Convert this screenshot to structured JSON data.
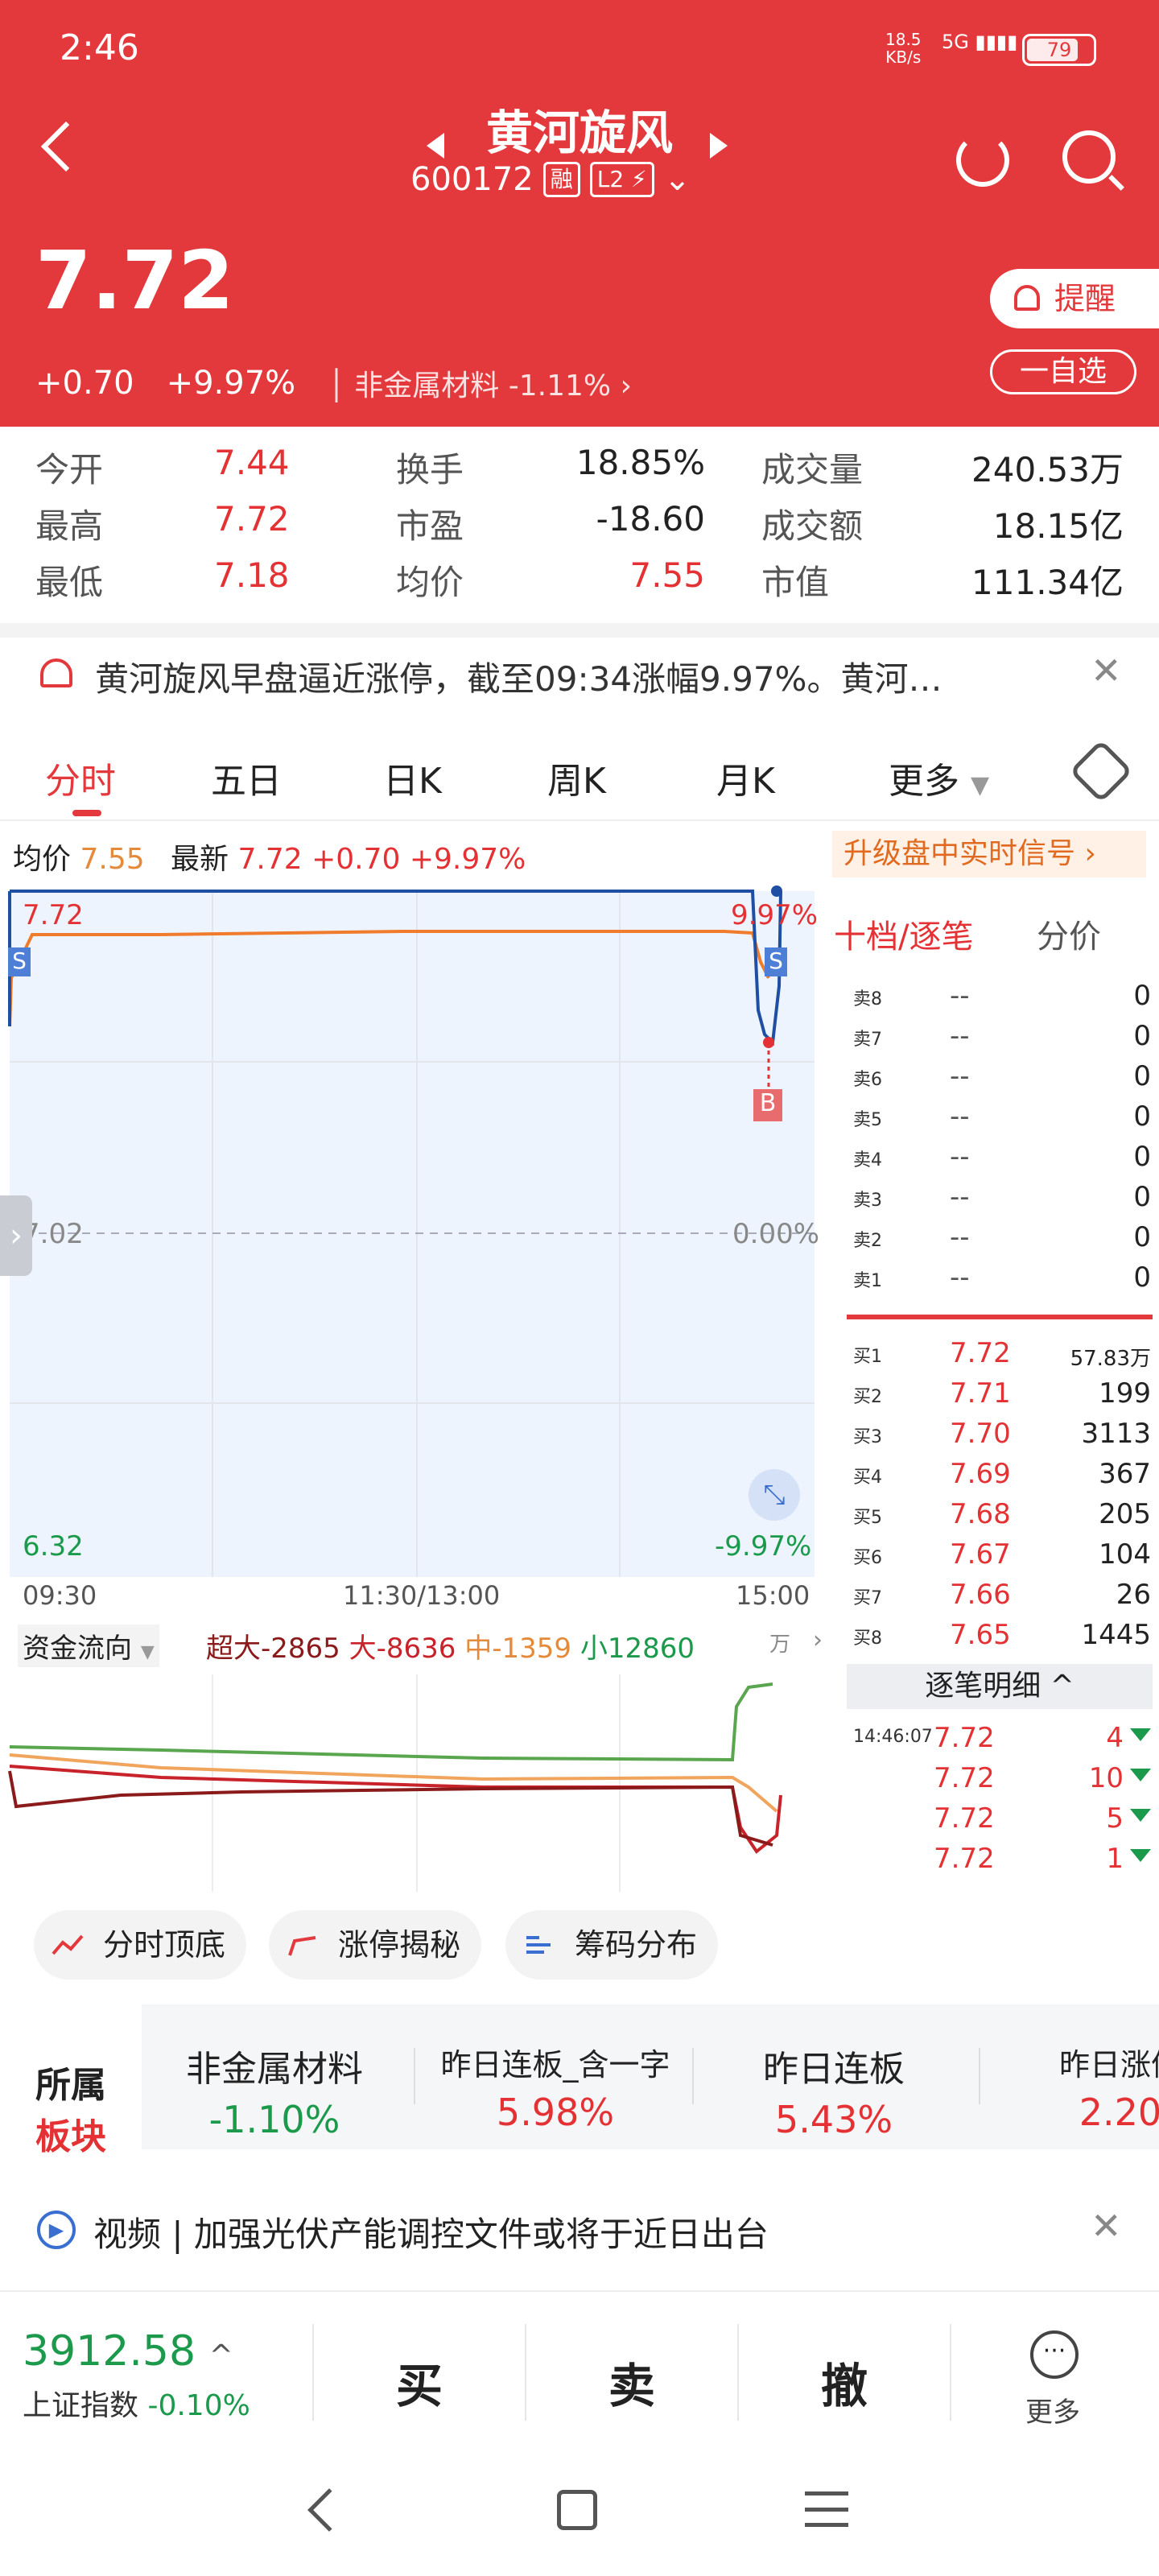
{
  "status": {
    "time": "2:46",
    "net_speed": "18.5",
    "net_unit": "KB/s",
    "signal": "5G",
    "battery": "79"
  },
  "header": {
    "name": "黄河旋风",
    "code": "600172",
    "tag_margin": "融",
    "tag_level": "L2",
    "price": "7.72",
    "change": "+0.70",
    "change_pct": "+9.97%",
    "sector": "非金属材料",
    "sector_pct": "-1.11%",
    "alert_label": "提醒",
    "watch_label": "一自选"
  },
  "quote": [
    {
      "label": "今开",
      "value": "7.44",
      "color": "#e43134"
    },
    {
      "label": "换手",
      "value": "18.85%",
      "color": "#222"
    },
    {
      "label": "成交量",
      "value": "240.53万",
      "color": "#222"
    },
    {
      "label": "最高",
      "value": "7.72",
      "color": "#e43134"
    },
    {
      "label": "市盈",
      "value": "-18.60",
      "color": "#222"
    },
    {
      "label": "成交额",
      "value": "18.15亿",
      "color": "#222"
    },
    {
      "label": "最低",
      "value": "7.18",
      "color": "#e43134"
    },
    {
      "label": "均价",
      "value": "7.55",
      "color": "#e43134"
    },
    {
      "label": "市值",
      "value": "111.34亿",
      "color": "#222"
    }
  ],
  "news": {
    "text": "黄河旋风早盘逼近涨停，截至09:34涨幅9.97%。黄河…"
  },
  "tabs": [
    "分时",
    "五日",
    "日K",
    "周K",
    "月K",
    "更多"
  ],
  "avgbar": {
    "avg_label": "均价",
    "avg": "7.55",
    "latest_label": "最新",
    "latest": "7.72",
    "change": "+0.70",
    "pct": "+9.97%",
    "upgrade": "升级盘中实时信号"
  },
  "chart": {
    "y_top_left": "7.72",
    "y_top_right": "9.97%",
    "y_mid_left": "7.02",
    "y_mid_right": "0.00%",
    "y_bot_left": "6.32",
    "y_bot_right": "-9.97%",
    "x_start": "09:30",
    "x_mid": "11:30/13:00",
    "x_end": "15:00",
    "marker_s": "S",
    "marker_b": "B"
  },
  "flow": {
    "label": "资金流向",
    "super": "超大-2865",
    "big": "大-8636",
    "mid": "中-1359",
    "small": "小12860",
    "unit": "万"
  },
  "book": {
    "title": "十档/逐笔",
    "tab2": "分价",
    "sells": [
      [
        "卖8",
        "--",
        "0"
      ],
      [
        "卖7",
        "--",
        "0"
      ],
      [
        "卖6",
        "--",
        "0"
      ],
      [
        "卖5",
        "--",
        "0"
      ],
      [
        "卖4",
        "--",
        "0"
      ],
      [
        "卖3",
        "--",
        "0"
      ],
      [
        "卖2",
        "--",
        "0"
      ],
      [
        "卖1",
        "--",
        "0"
      ]
    ],
    "buys": [
      [
        "买1",
        "7.72",
        "57.83万"
      ],
      [
        "买2",
        "7.71",
        "199"
      ],
      [
        "买3",
        "7.70",
        "3113"
      ],
      [
        "买4",
        "7.69",
        "367"
      ],
      [
        "买5",
        "7.68",
        "205"
      ],
      [
        "买6",
        "7.67",
        "104"
      ],
      [
        "买7",
        "7.66",
        "26"
      ],
      [
        "买8",
        "7.65",
        "1445"
      ]
    ],
    "ticks_title": "逐笔明细",
    "ticks": [
      [
        "14:46:07",
        "7.72",
        "4"
      ],
      [
        "",
        "7.72",
        "10"
      ],
      [
        "",
        "7.72",
        "5"
      ],
      [
        "",
        "7.72",
        "1"
      ]
    ]
  },
  "chips": [
    "分时顶底",
    "涨停揭秘",
    "筹码分布"
  ],
  "sector": {
    "title1": "所属",
    "title2": "板块",
    "cards": [
      [
        "非金属材料",
        "-1.10%"
      ],
      [
        "昨日连板_含一字",
        "5.98%"
      ],
      [
        "昨日连板",
        "5.43%"
      ],
      [
        "昨日涨停",
        "2.20"
      ]
    ]
  },
  "video": {
    "text": "视频 | 加强光伏产能调控文件或将于近日出台"
  },
  "bottom": {
    "index": "3912.58",
    "index_name": "上证指数",
    "index_pct": "-0.10%",
    "buy": "买",
    "sell": "卖",
    "cancel": "撤",
    "more": "更多"
  }
}
